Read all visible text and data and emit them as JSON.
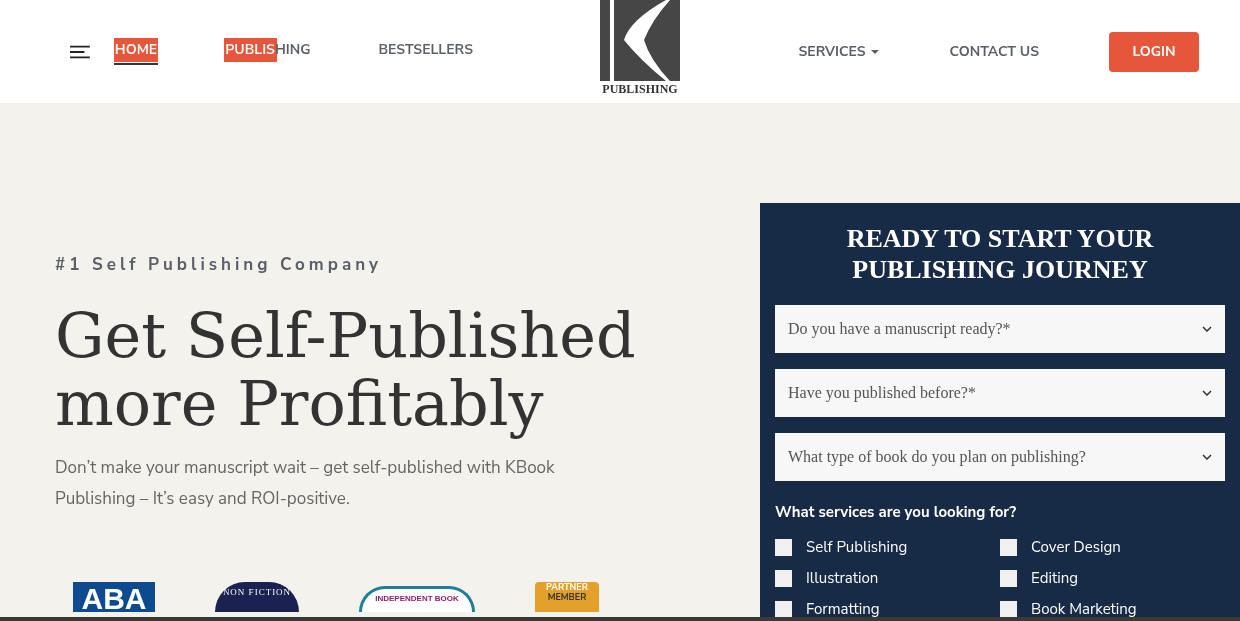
{
  "nav": {
    "left": [
      {
        "label": "HOME",
        "selected": true,
        "level": 1
      },
      {
        "label": "PUBLISHING",
        "selected": false,
        "level": 0.6
      },
      {
        "label": "BESTSELLERS",
        "selected": false
      }
    ],
    "logo": {
      "text": "PUBLISHING"
    },
    "right": [
      {
        "label": "SERVICES",
        "kind": "dropdown"
      },
      {
        "label": "CONTACT US",
        "kind": "link"
      }
    ],
    "login": "LOGIN"
  },
  "hero": {
    "eyebrow": "#1 Self Publishing Company",
    "title": "Get Self-Published more Profitably",
    "text": "Don’t make your manuscript wait – get self-published with KBook Publishing – It’s easy and ROI-positive."
  },
  "badges": [
    {
      "kind": "aba",
      "text": "ABA"
    },
    {
      "kind": "seal",
      "text": "NON FICTION"
    },
    {
      "kind": "oval",
      "text": "INDEPENDENT BOOK"
    },
    {
      "kind": "partner",
      "text": "PARTNER",
      "subtext": "MEMBER"
    }
  ],
  "form": {
    "title": "READY TO START YOUR PUBLISHING JOURNEY",
    "selects": [
      {
        "placeholder": "Do you have a manuscript ready?*"
      },
      {
        "placeholder": "Have you published before?*"
      },
      {
        "placeholder": "What type of book do you plan on publishing?"
      }
    ],
    "services_label": "What services are you looking for?",
    "services": [
      {
        "label": "Self Publishing",
        "checked": false
      },
      {
        "label": "Cover Design",
        "checked": false
      },
      {
        "label": "Illustration",
        "checked": false
      },
      {
        "label": "Editing",
        "checked": false
      },
      {
        "label": "Formatting",
        "checked": false
      },
      {
        "label": "Book Marketing",
        "checked": false
      }
    ]
  }
}
